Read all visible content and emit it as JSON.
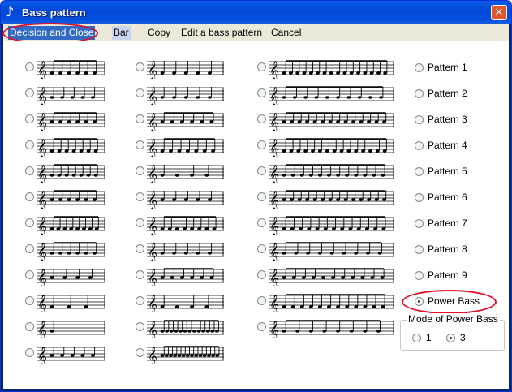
{
  "window": {
    "title": "Bass pattern",
    "close_glyph": "✕"
  },
  "menu": [
    {
      "label": "Decision and Close",
      "state": "selected"
    },
    {
      "label": "Bar",
      "state": "hover"
    },
    {
      "label": "Copy",
      "state": "normal"
    },
    {
      "label": "Edit a bass pattern",
      "state": "normal"
    },
    {
      "label": "Cancel",
      "state": "normal"
    }
  ],
  "staff_radio_count": 36,
  "patterns": [
    "Pattern 1",
    "Pattern 2",
    "Pattern 3",
    "Pattern 4",
    "Pattern 5",
    "Pattern 6",
    "Pattern 7",
    "Pattern 8",
    "Pattern 9",
    "Power Bass"
  ],
  "selected_pattern": "Power Bass",
  "mode_group": {
    "title": "Mode of Power Bass",
    "options": [
      "1",
      "3"
    ],
    "selected": "3"
  },
  "colors": {
    "title_bar": "#0347d6",
    "menu_bg": "#ece9d8",
    "selection": "#316ac5",
    "highlight": "#e0102a"
  }
}
